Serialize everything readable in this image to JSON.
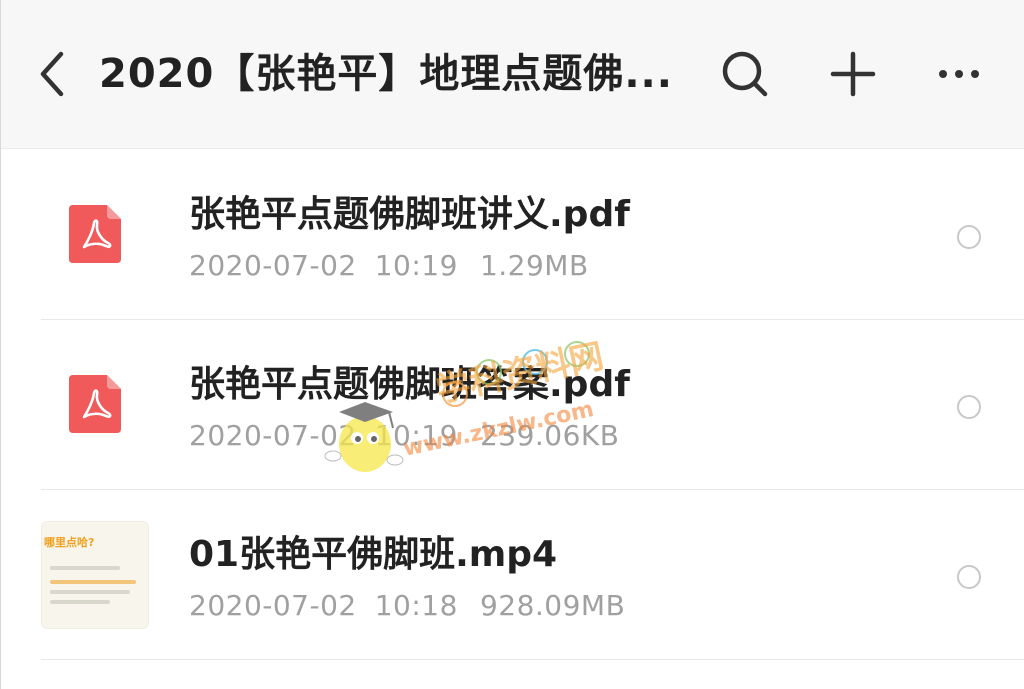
{
  "header": {
    "title": "2020【张艳平】地理点题佛..."
  },
  "icons": {
    "back": "chevron-left-icon",
    "search": "search-icon",
    "add": "plus-icon",
    "more": "more-horizontal-icon",
    "pdf": "pdf-file-icon",
    "video": "video-thumbnail"
  },
  "colors": {
    "pdf_red": "#f05a5a",
    "text_primary": "#222222",
    "text_secondary": "#a0a0a0"
  },
  "files": [
    {
      "name": "张艳平点题佛脚班讲义.pdf",
      "date": "2020-07-02",
      "time": "10:19",
      "size": "1.29MB",
      "type": "pdf",
      "selected": false
    },
    {
      "name": "张艳平点题佛脚班答案.pdf",
      "date": "2020-07-02",
      "time": "10:19",
      "size": "239.06KB",
      "type": "pdf",
      "selected": false
    },
    {
      "name": "01张艳平佛脚班.mp4",
      "date": "2020-07-02",
      "time": "10:18",
      "size": "928.09MB",
      "type": "video",
      "selected": false
    }
  ],
  "thumbnail_text": {
    "heading": "哪里点哈?"
  },
  "watermark": {
    "brand": "学科资料网",
    "url": "www.zkzlw.com"
  }
}
